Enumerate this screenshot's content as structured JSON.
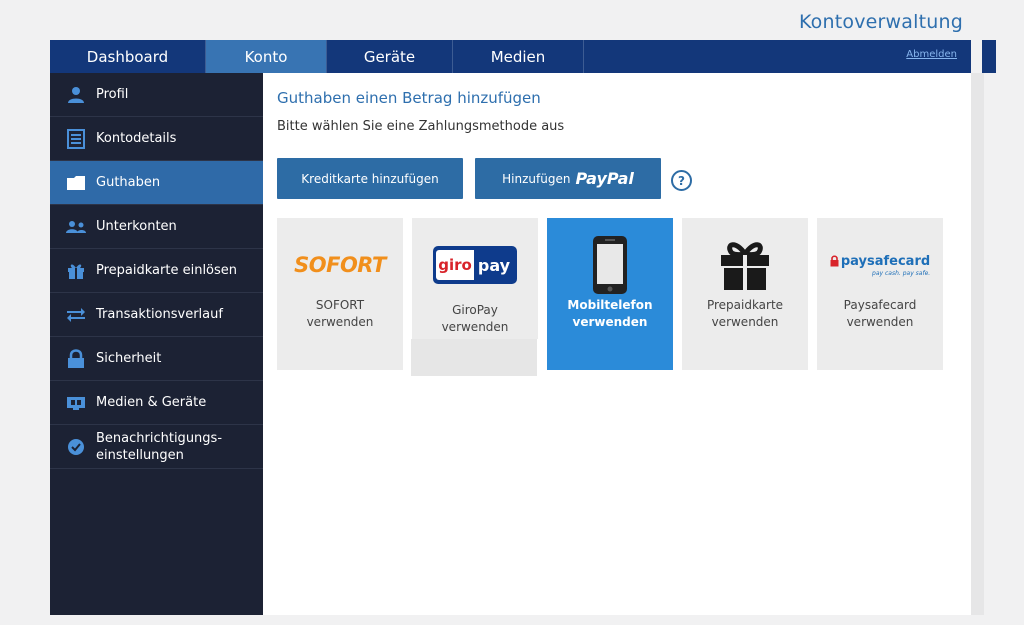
{
  "page_title": "Kontoverwaltung",
  "nav": {
    "tabs": [
      {
        "label": "Dashboard"
      },
      {
        "label": "Konto"
      },
      {
        "label": "Geräte"
      },
      {
        "label": "Medien"
      }
    ],
    "active_tab": "Konto",
    "logout_label": "Abmelden"
  },
  "sidebar": {
    "items": [
      {
        "label": "Profil",
        "icon": "user-icon"
      },
      {
        "label": "Kontodetails",
        "icon": "document-icon"
      },
      {
        "label": "Guthaben",
        "icon": "wallet-icon"
      },
      {
        "label": "Unterkonten",
        "icon": "users-icon"
      },
      {
        "label": "Prepaidkarte einlösen",
        "icon": "gift-icon"
      },
      {
        "label": "Transaktionsverlauf",
        "icon": "swap-arrows-icon"
      },
      {
        "label": "Sicherheit",
        "icon": "lock-icon"
      },
      {
        "label": "Medien & Geräte",
        "icon": "media-device-icon"
      },
      {
        "label_line1": "Benachrichtigungs-",
        "label_line2": "einstellungen",
        "icon": "badge-check-icon"
      }
    ],
    "active_item": "Guthaben"
  },
  "main": {
    "heading": "Guthaben einen Betrag hinzufügen",
    "subheading": "Bitte wählen Sie eine Zahlungsmethode aus",
    "buttons": {
      "credit_card": "Kreditkarte hinzufügen",
      "paypal_prefix": "Hinzufügen",
      "paypal_brand": "PayPal",
      "help": "?"
    },
    "methods": [
      {
        "logo_text": "SOFORT",
        "line1": "SOFORT",
        "line2": "verwenden"
      },
      {
        "logo_text_a": "giro",
        "logo_text_b": "pay",
        "line1": "GiroPay",
        "line2": "verwenden"
      },
      {
        "line1": "Mobiltelefon",
        "line2": "verwenden",
        "active": true
      },
      {
        "line1": "Prepaidkarte",
        "line2": "verwenden"
      },
      {
        "logo_text": "paysafecard",
        "logo_sub": "pay cash. pay safe.",
        "line1": "Paysafecard",
        "line2": "verwenden"
      }
    ]
  },
  "colors": {
    "nav_bg": "#13377a",
    "active_tab": "#3874b3",
    "sidebar_bg": "#1c2234",
    "sidebar_active": "#2f6aa8",
    "accent": "#2d6ca5",
    "tile_active": "#2b8bd9",
    "sofort_orange": "#f18f1c",
    "giropay_red": "#d8232a",
    "giropay_blue": "#0e3b8c"
  }
}
